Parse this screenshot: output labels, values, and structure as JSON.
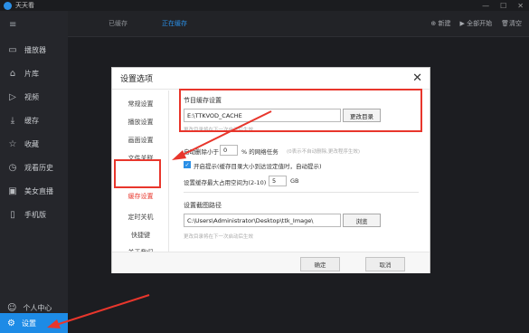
{
  "app": {
    "title": "天天看"
  },
  "window_controls": {
    "menu": "≡",
    "minimize": "—",
    "maximize": "☐",
    "close": "✕"
  },
  "sidebar": {
    "items": [
      {
        "label": "播放器",
        "icon": "tv-icon"
      },
      {
        "label": "片库",
        "icon": "home-icon"
      },
      {
        "label": "视频",
        "icon": "play-circle-icon"
      },
      {
        "label": "缓存",
        "icon": "download-icon"
      },
      {
        "label": "收藏",
        "icon": "star-icon"
      },
      {
        "label": "观看历史",
        "icon": "clock-icon"
      },
      {
        "label": "美女直播",
        "icon": "tv-live-icon"
      },
      {
        "label": "手机版",
        "icon": "phone-icon"
      }
    ],
    "user": {
      "label": "个人中心"
    },
    "settings": {
      "label": "设置"
    }
  },
  "main": {
    "tabs": [
      {
        "label": "已缓存",
        "active": false
      },
      {
        "label": "正在缓存",
        "active": true
      }
    ],
    "actions": {
      "new": "新建",
      "start_all": "全部开始",
      "clear": "清空"
    }
  },
  "dialog": {
    "title": "设置选项",
    "nav": [
      {
        "label": "常规设置",
        "selected": false
      },
      {
        "label": "播放设置",
        "selected": false
      },
      {
        "label": "画面设置",
        "selected": false
      },
      {
        "label": "文件关联",
        "selected": false
      },
      {
        "label": "缓存设置",
        "selected": true
      },
      {
        "label": "定时关机",
        "selected": false
      },
      {
        "label": "快捷键",
        "selected": false
      },
      {
        "label": "关于我们",
        "selected": false
      }
    ],
    "cache": {
      "section_title": "节目缓存设置",
      "path": "E:\\TTKVOD_CACHE",
      "change_dir_button": "更改目录",
      "path_hint": "更改目录将在下一次启动后生效",
      "auto_delete_prefix": "自动删除小于",
      "auto_delete_value": "0",
      "auto_delete_suffix": "% 的网络任务",
      "auto_delete_hint": "(0表示不自动删除,更改程序生效)",
      "prompt_checkbox": "开启提示(缓存目录大小到达设定值时，自动提示)",
      "max_space_label": "设置缓存最大占用空间为(2-10)",
      "max_space_value": "5",
      "max_space_unit": "GB"
    },
    "screenshot": {
      "section_title": "设置截图路径",
      "path": "C:\\Users\\Administrator\\Desktop\\ttk_Image\\",
      "browse_button": "浏览",
      "path_hint": "更改目录将在下一次启动后生效"
    },
    "ok_button": "确定",
    "cancel_button": "取消"
  },
  "colors": {
    "accent": "#1d8be6",
    "highlight": "#e8362c"
  }
}
